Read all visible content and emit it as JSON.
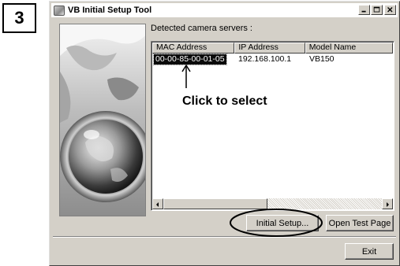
{
  "step": {
    "number": "3"
  },
  "window": {
    "title": "VB Initial Setup Tool",
    "icons": {
      "app": "camera-icon",
      "minimize": "minimize-icon",
      "maximize": "maximize-icon",
      "close": "close-icon"
    }
  },
  "servers": {
    "label": "Detected camera servers :",
    "columns": [
      "MAC Address",
      "IP Address",
      "Model Name"
    ],
    "rows": [
      {
        "mac": "00-00-85-00-01-05",
        "ip": "192.168.100.1",
        "model": "VB150",
        "selected": true
      }
    ]
  },
  "annotation": {
    "text": "Click to select"
  },
  "buttons": {
    "initial_setup": "Initial Setup...",
    "open_test_page": "Open Test Page",
    "exit": "Exit"
  },
  "colors": {
    "window_face": "#d4d0c8",
    "selection": "#0a0a0a",
    "titlebar": "#ffffff"
  }
}
